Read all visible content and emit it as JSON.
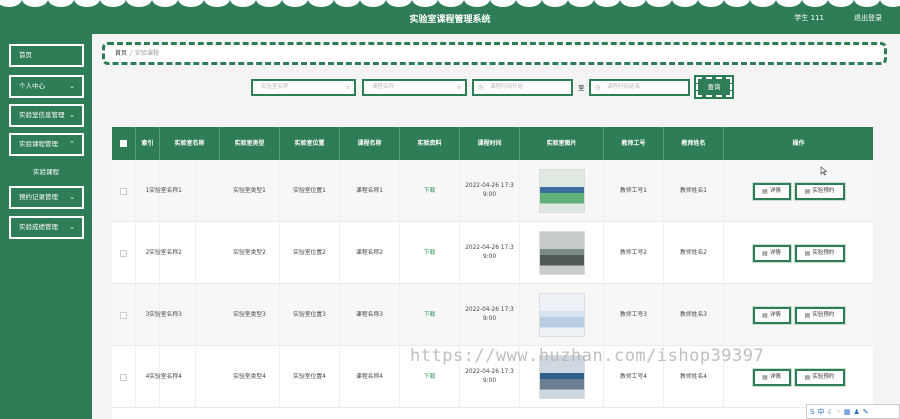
{
  "header": {
    "title": "实验室课程管理系统",
    "user": "学生 111",
    "logout": "退出登录"
  },
  "sidebar": {
    "items": [
      {
        "label": "首页",
        "has_chevron": false
      },
      {
        "label": "个人中心",
        "has_chevron": true
      },
      {
        "label": "实验室信息管理",
        "has_chevron": true
      },
      {
        "label": "实验课程管理",
        "has_chevron": true
      },
      {
        "label": "预约记录管理",
        "has_chevron": true
      },
      {
        "label": "实验成绩管理",
        "has_chevron": true
      }
    ],
    "submenu": {
      "label": "实验课程"
    }
  },
  "breadcrumb": {
    "home": "首页",
    "separator": "/",
    "current": "实验课程"
  },
  "search": {
    "lab_name_placeholder": "实验室名称",
    "course_name_placeholder": "课程名称",
    "start_time_placeholder": "课程时间开始",
    "end_time_placeholder": "课程时间结束",
    "range_sep": "至",
    "query_label": "查询"
  },
  "table": {
    "headers": [
      "",
      "索引",
      "实验室名称",
      "实验室类型",
      "实验室位置",
      "课程名称",
      "实验资料",
      "课程时间",
      "实验室图片",
      "教师工号",
      "教师姓名",
      "操作"
    ],
    "rows": [
      {
        "index": "1",
        "lab_name": "实验室名称1",
        "lab_type": "实验室类型1",
        "lab_location": "实验室位置1",
        "course_name": "课程名称1",
        "material": "下载",
        "time_line1": "2022-04-26 17:3",
        "time_line2": "9:00",
        "teacher_id": "教师工号1",
        "teacher_name": "教师姓名1"
      },
      {
        "index": "2",
        "lab_name": "实验室名称2",
        "lab_type": "实验室类型2",
        "lab_location": "实验室位置2",
        "course_name": "课程名称2",
        "material": "下载",
        "time_line1": "2022-04-26 17:3",
        "time_line2": "9:00",
        "teacher_id": "教师工号2",
        "teacher_name": "教师姓名2"
      },
      {
        "index": "3",
        "lab_name": "实验室名称3",
        "lab_type": "实验室类型3",
        "lab_location": "实验室位置3",
        "course_name": "课程名称3",
        "material": "下载",
        "time_line1": "2022-04-26 17:3",
        "time_line2": "9:00",
        "teacher_id": "教师工号3",
        "teacher_name": "教师姓名3"
      },
      {
        "index": "4",
        "lab_name": "实验室名称4",
        "lab_type": "实验室类型4",
        "lab_location": "实验室位置4",
        "course_name": "课程名称4",
        "material": "下载",
        "time_line1": "2022-04-26 17:3",
        "time_line2": "9:00",
        "teacher_id": "教师工号4",
        "teacher_name": "教师姓名4"
      }
    ],
    "actions": {
      "detail": "详情",
      "reserve": "实验预约"
    }
  },
  "watermark": "https://www.huzhan.com/ishop39397",
  "colors": {
    "primary": "#2f7d56",
    "download": "#2f9a5c"
  }
}
